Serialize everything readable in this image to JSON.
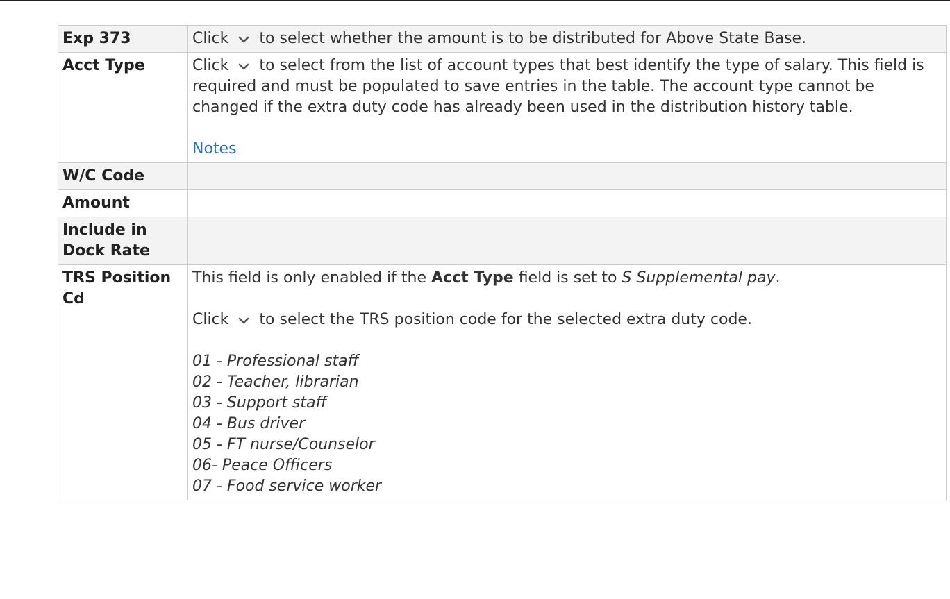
{
  "rows": [
    {
      "field": "Exp 373",
      "pre": "Click",
      "icon": "chevron-down-icon",
      "post": "to select whether the amount is to be distributed for Above State Base."
    },
    {
      "field": "Acct Type",
      "pre": "Click",
      "icon": "chevron-down-icon",
      "post": "to select from the list of account types that best identify the type of salary. This field is required and must be populated to save entries in the table. The account type cannot be changed if the extra duty code has already been used in the distribution history table.",
      "link": "Notes"
    },
    {
      "field": "W/C Code"
    },
    {
      "field": "Amount"
    },
    {
      "field": "Include in Dock Rate"
    },
    {
      "field": "TRS Position Cd",
      "p1_pre": "This field is only enabled if the",
      "p1_bold": "Acct Type",
      "p1_mid": "field is set to",
      "p1_italic": "S Supplemental pay",
      "p1_end": ".",
      "p2_pre": "Click",
      "icon": "chevron-down-icon",
      "p2_post": "to select the TRS position code for the selected extra duty code.",
      "options": [
        "01 - Professional staff",
        "02 - Teacher, librarian",
        "03 - Support staff",
        "04 - Bus driver",
        "05 - FT nurse/Counselor",
        "06- Peace Officers",
        "07 - Food service worker"
      ]
    }
  ]
}
